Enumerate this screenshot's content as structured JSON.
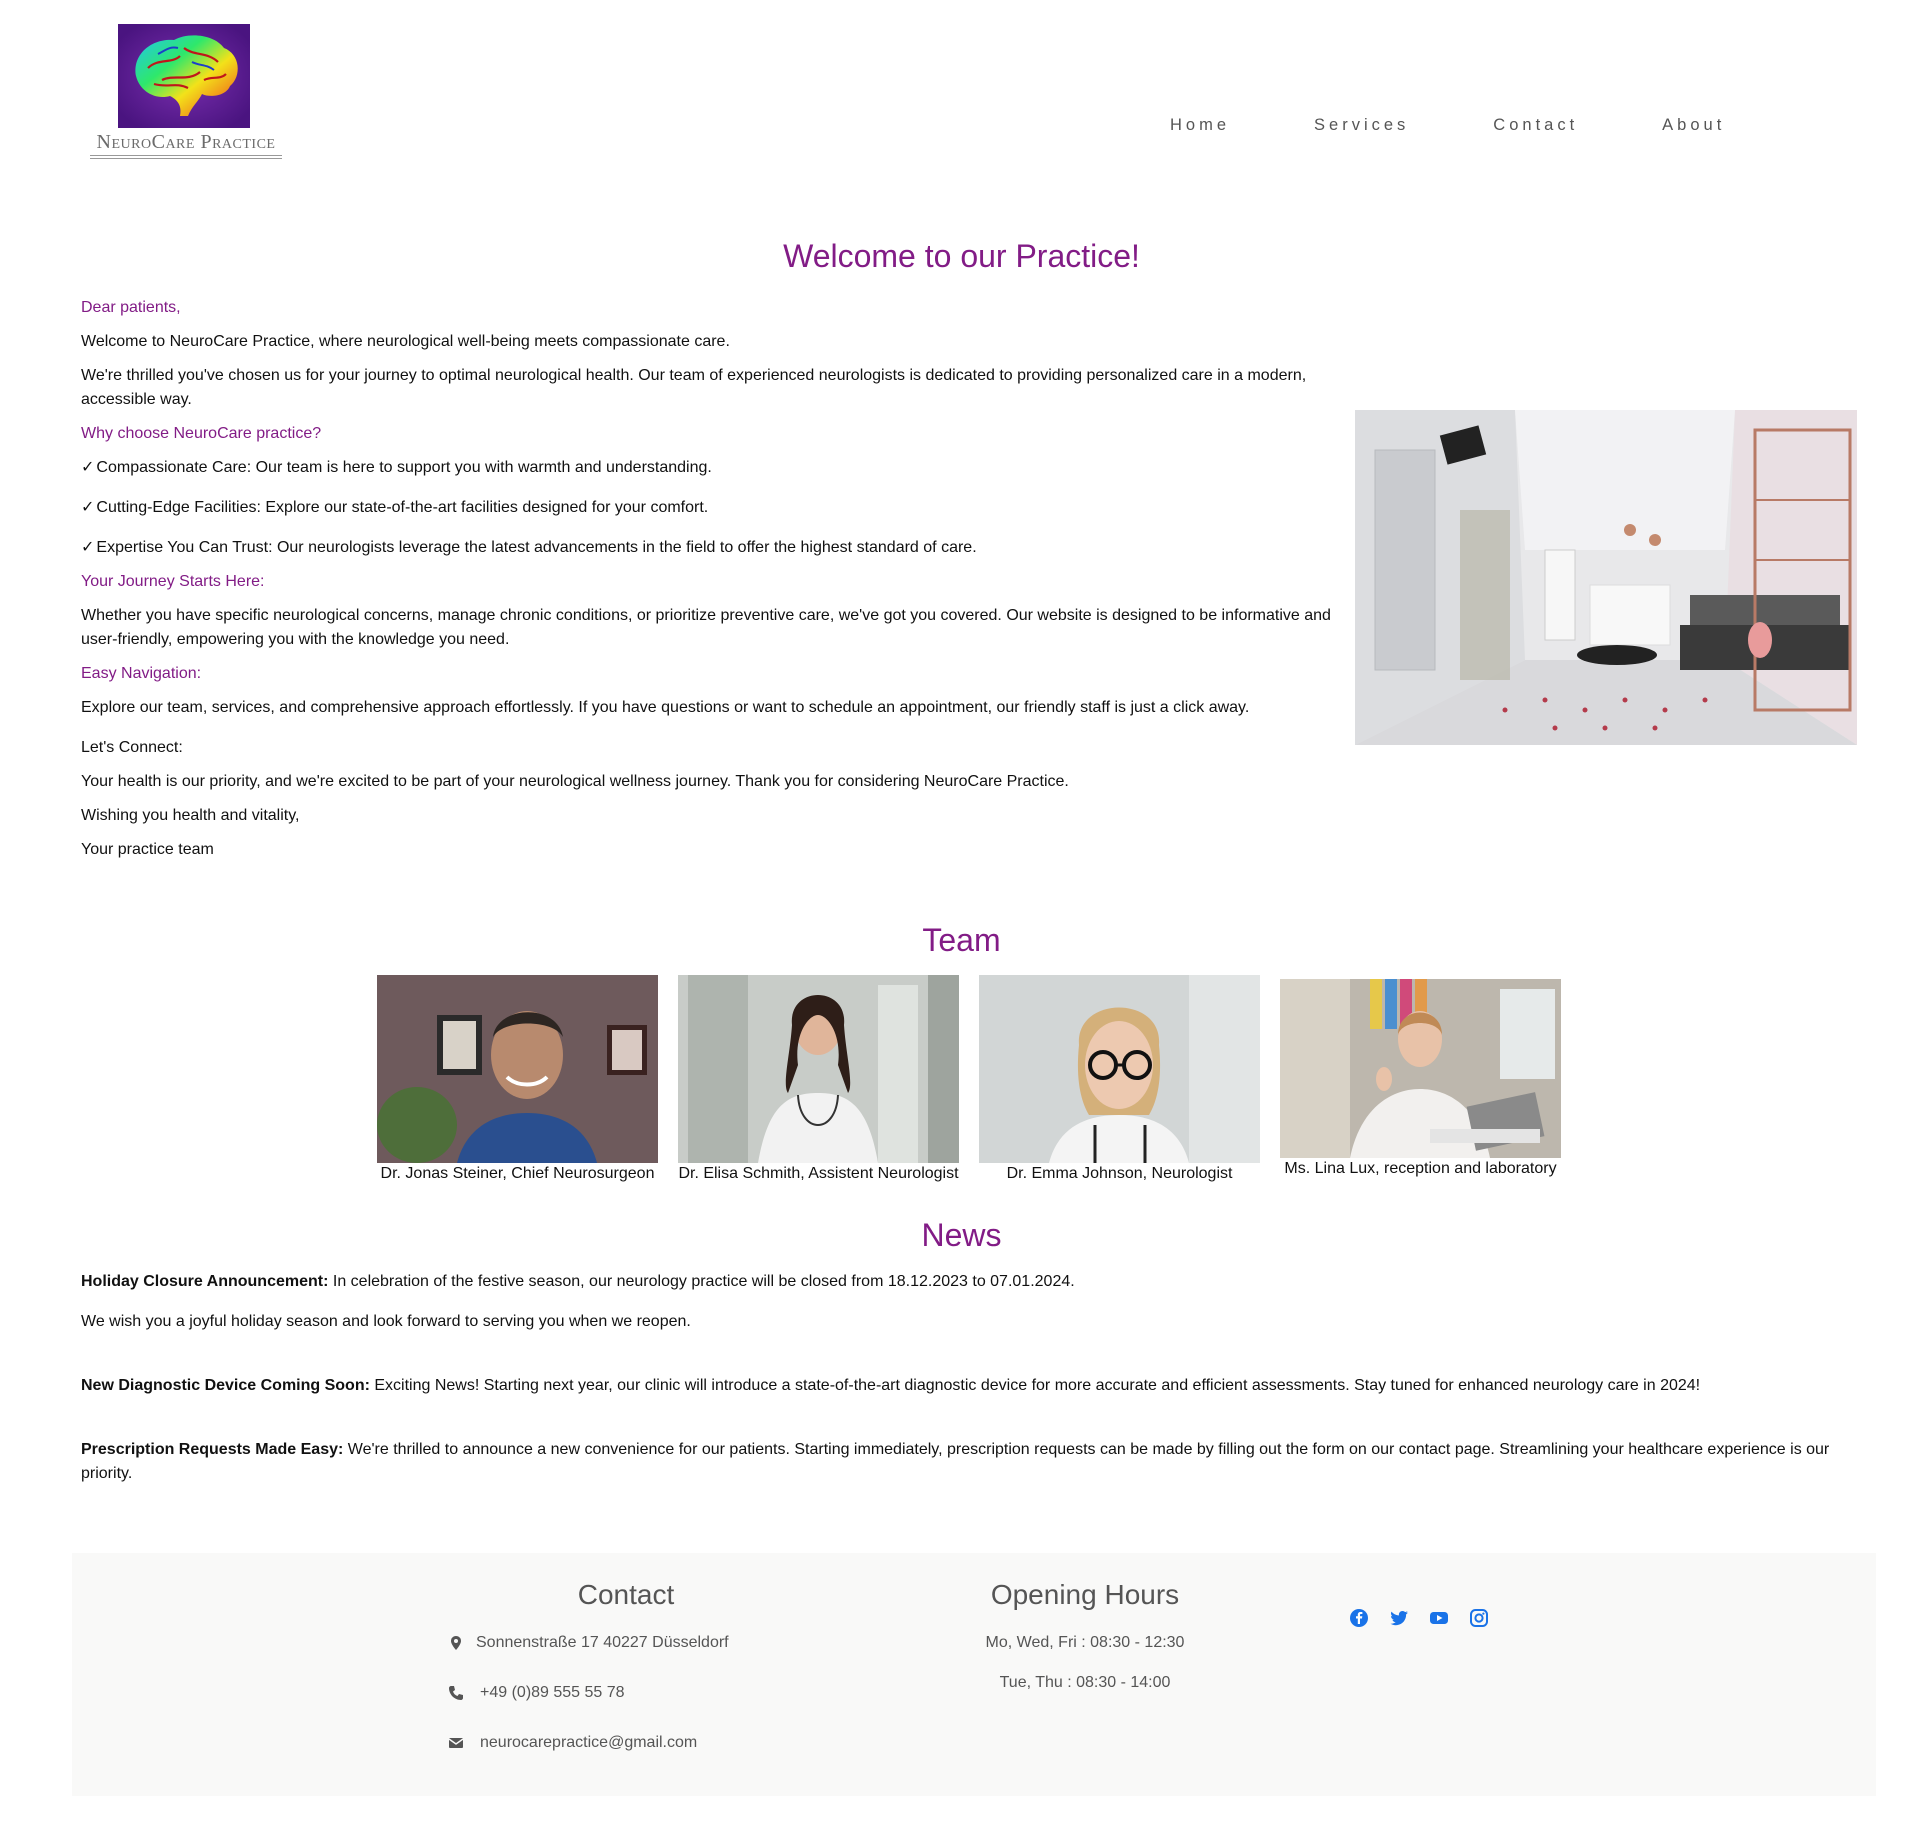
{
  "header": {
    "logo_text": "NeuroCare Practice",
    "nav": [
      "Home",
      "Services",
      "Contact",
      "About"
    ]
  },
  "welcome": {
    "title": "Welcome to our Practice!",
    "greeting": "Dear patients,",
    "intro": "Welcome to NeuroCare Practice, where neurological well-being meets compassionate care.",
    "thrilled": "We're thrilled you've chosen us for your journey to optimal neurological health. Our team of experienced neurologists is dedicated to providing personalized care in a modern, accessible way.",
    "why_heading": "Why choose NeuroCare practice?",
    "checkmark": "✓",
    "points": [
      "Compassionate Care: Our team is here to support you with warmth and understanding.",
      "Cutting-Edge Facilities: Explore our state-of-the-art facilities designed for your comfort.",
      "Expertise You Can Trust: Our neurologists leverage the latest advancements in the field to offer the highest standard of care."
    ],
    "journey_heading": "Your Journey Starts Here:",
    "journey_text": "Whether you have specific neurological concerns, manage chronic conditions, or prioritize preventive care, we've got you covered. Our website is designed to be informative and user-friendly, empowering you with the knowledge you need.",
    "nav_heading": "Easy Navigation:",
    "nav_text": "Explore our team, services, and comprehensive approach effortlessly. If you have questions or want to schedule an appointment, our friendly staff is just a click away.",
    "connect": "Let's Connect:",
    "priority": "Your health is our priority, and we're excited to be part of your neurological wellness journey. Thank you for considering NeuroCare Practice.",
    "wishing": "Wishing you health and vitality,",
    "signoff": "Your practice team"
  },
  "team": {
    "title": "Team",
    "members": [
      "Dr. Jonas Steiner, Chief Neurosurgeon",
      "Dr. Elisa Schmith, Assistent Neurologist",
      "Dr. Emma Johnson, Neurologist",
      "Ms. Lina Lux, reception and laboratory"
    ]
  },
  "news": {
    "title": "News",
    "items": [
      {
        "bold": "Holiday Closure Announcement:",
        "text": " In celebration of the festive season, our neurology practice will be closed from 18.12.2023 to 07.01.2024."
      },
      {
        "bold": "",
        "text": "We wish you a joyful holiday season and look forward to serving you when we reopen."
      },
      {
        "bold": "New Diagnostic Device Coming Soon:",
        "text": " Exciting News! Starting next year, our clinic will introduce a state-of-the-art diagnostic device for more accurate and efficient assessments. Stay tuned for enhanced neurology care in 2024!"
      },
      {
        "bold": "Prescription Requests Made Easy:",
        "text": " We're thrilled to announce a new convenience for our patients. Starting immediately, prescription requests can be made by filling out the form on our contact page. Streamlining your healthcare experience is our priority."
      }
    ]
  },
  "footer": {
    "contact_title": "Contact",
    "address": "Sonnenstraße 17 40227 Düsseldorf",
    "phone": "+49 (0)89 555 55 78",
    "email": "neurocarepractice@gmail.com",
    "hours_title": "Opening Hours",
    "hours": [
      "Mo, Wed, Fri : 08:30 - 12:30",
      "Tue, Thu : 08:30 - 14:00"
    ],
    "social": [
      "facebook-icon",
      "twitter-icon",
      "youtube-icon",
      "instagram-icon"
    ],
    "icon_color": "#1a73e8"
  },
  "colors": {
    "accent": "#821c86",
    "text": "#111111",
    "footer_bg": "#f9f9f8"
  }
}
